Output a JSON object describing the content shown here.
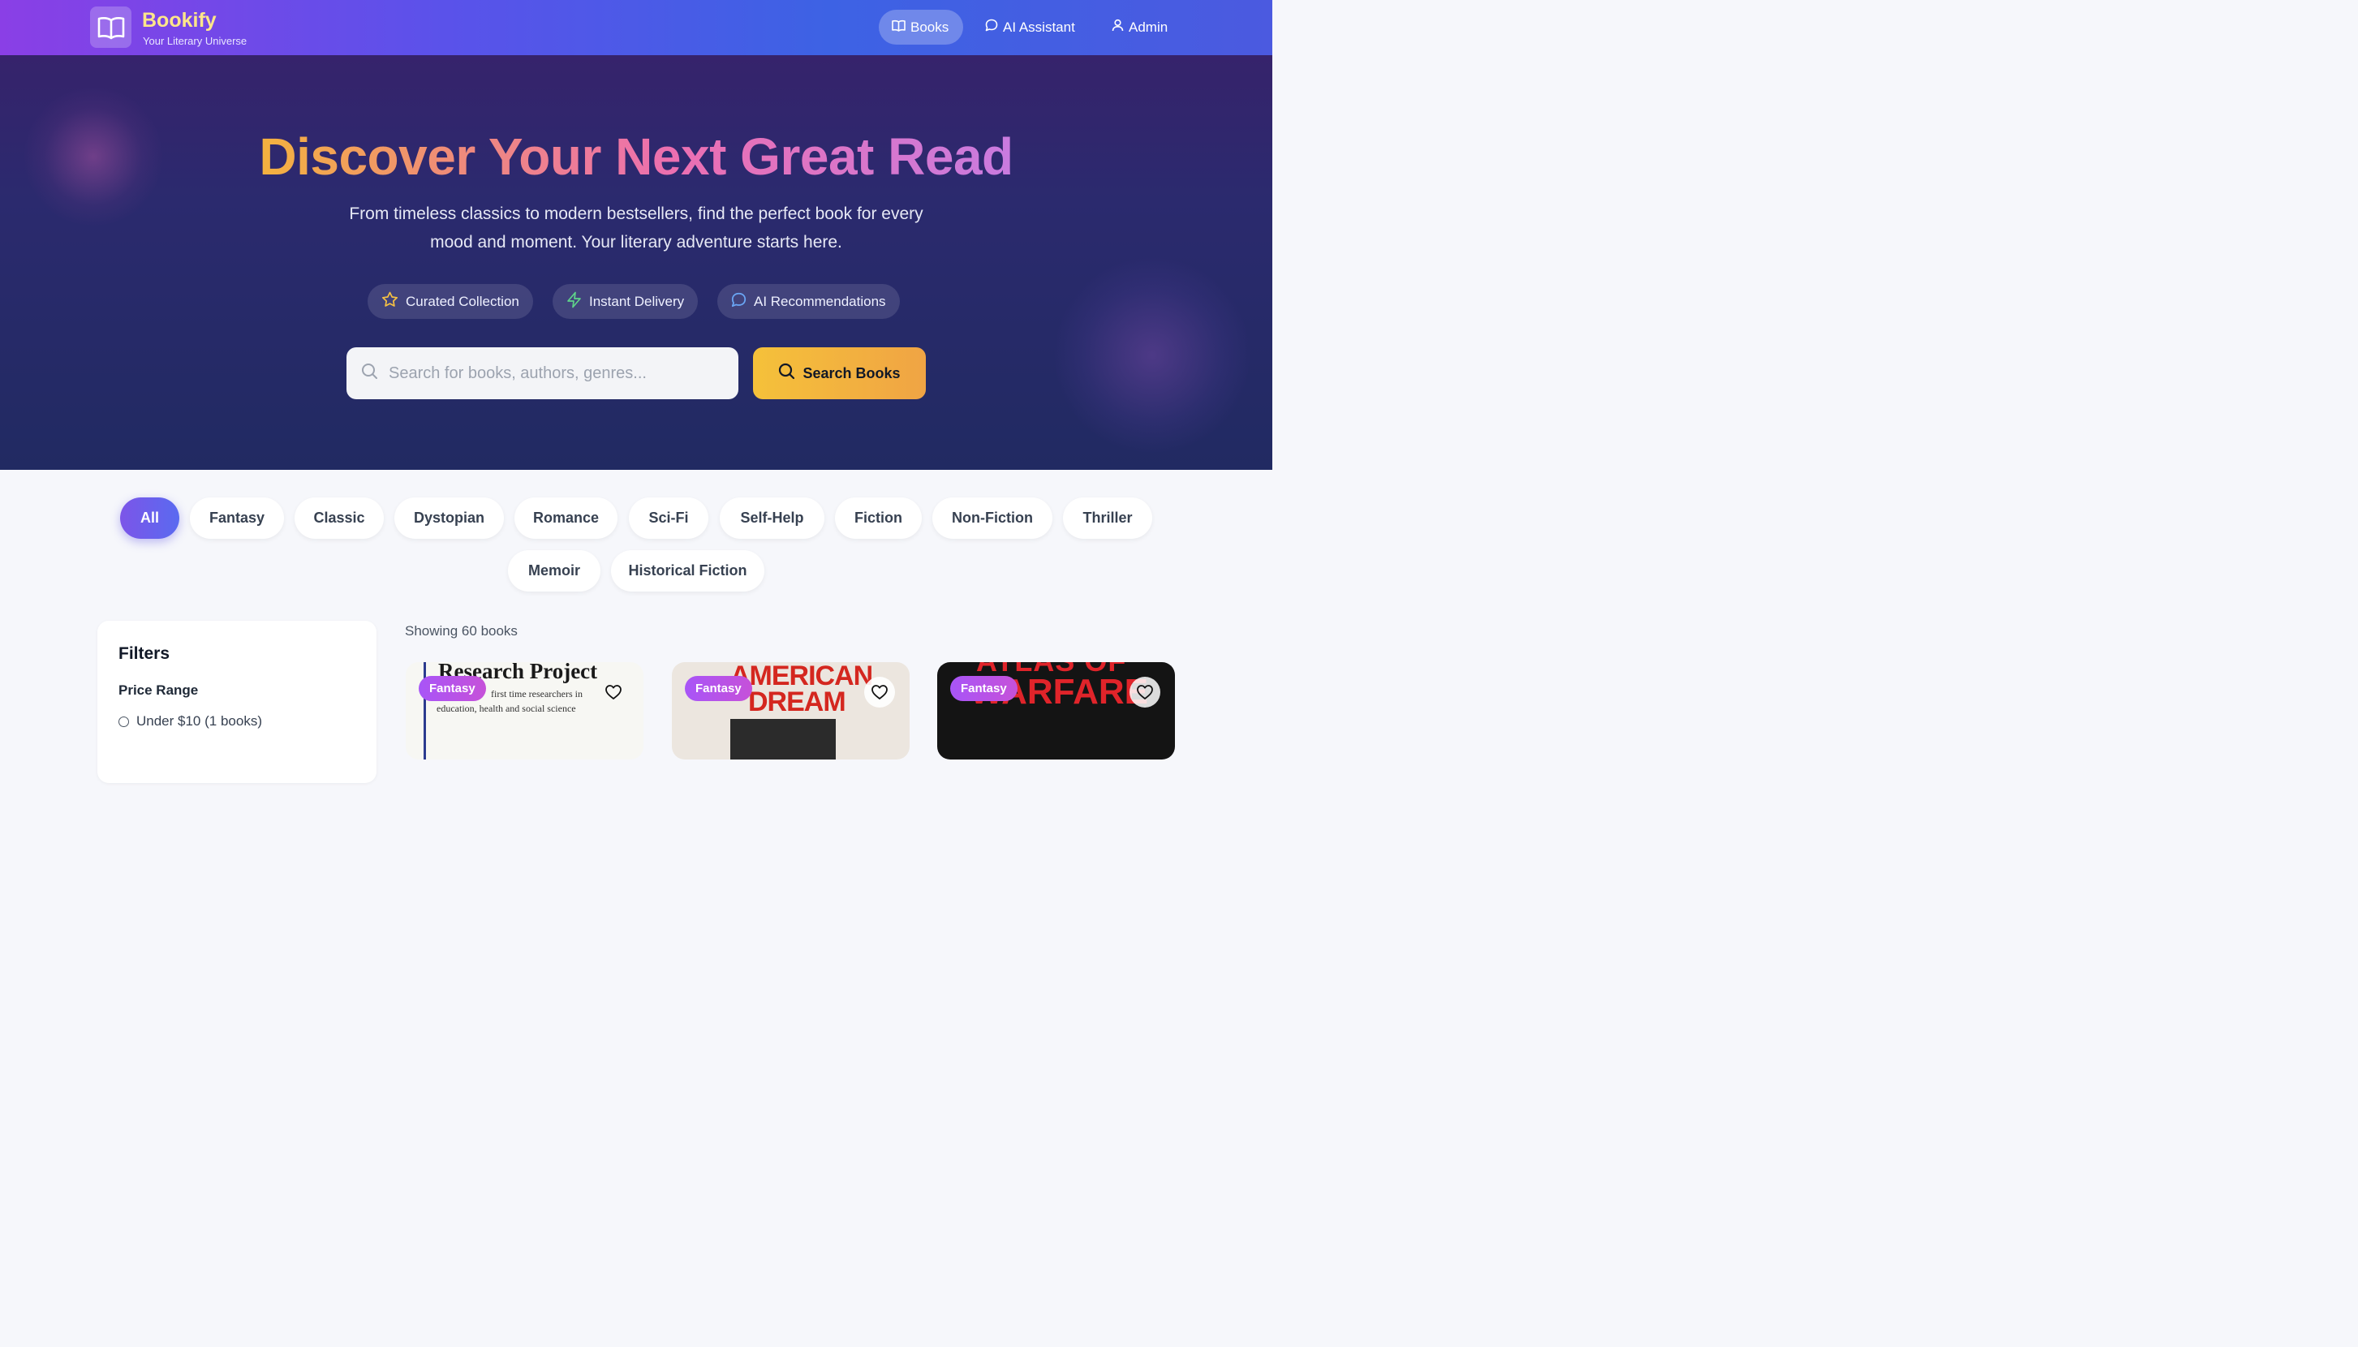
{
  "brand": {
    "name": "Bookify",
    "tagline": "Your Literary Universe",
    "logo_icon": "open-book-icon"
  },
  "nav": {
    "items": [
      {
        "label": "Books",
        "icon": "book-icon",
        "active": true
      },
      {
        "label": "AI Assistant",
        "icon": "chat-bubble-icon",
        "active": false
      },
      {
        "label": "Admin",
        "icon": "user-icon",
        "active": false
      }
    ]
  },
  "hero": {
    "title": "Discover Your Next Great Read",
    "subtitle": "From timeless classics to modern bestsellers, find the perfect book for every mood and moment. Your literary adventure starts here.",
    "features": [
      {
        "label": "Curated Collection",
        "icon": "star-icon",
        "color": "#f6c143"
      },
      {
        "label": "Instant Delivery",
        "icon": "lightning-icon",
        "color": "#5fd38a"
      },
      {
        "label": "AI Recommendations",
        "icon": "chat-bubble-icon",
        "color": "#6aa6f5"
      }
    ],
    "search_placeholder": "Search for books, authors, genres...",
    "search_button": "Search Books"
  },
  "genres": {
    "items": [
      "All",
      "Fantasy",
      "Classic",
      "Dystopian",
      "Romance",
      "Sci-Fi",
      "Self-Help",
      "Fiction",
      "Non-Fiction",
      "Thriller",
      "Memoir",
      "Historical Fiction"
    ],
    "active": "All"
  },
  "filters": {
    "title": "Filters",
    "price_range": {
      "title": "Price Range",
      "options": [
        {
          "label": "Under $10 (1 books)",
          "selected": false
        }
      ]
    }
  },
  "results": {
    "count_text": "Showing 60 books"
  },
  "books": [
    {
      "genre": "Fantasy",
      "cover_lines": [
        "Research Project",
        "first time researchers in",
        "education, health and social science"
      ]
    },
    {
      "genre": "Fantasy",
      "cover_lines": [
        "AMERICAN",
        "DREAM"
      ]
    },
    {
      "genre": "Fantasy",
      "cover_lines": [
        "ATLAS OF",
        "WARFARE"
      ]
    }
  ],
  "colors": {
    "brand_gradient_start": "#8a3fe6",
    "brand_gradient_end": "#3d62e4",
    "accent_yellow": "#f5c13a",
    "genre_badge": "#b054e8"
  }
}
